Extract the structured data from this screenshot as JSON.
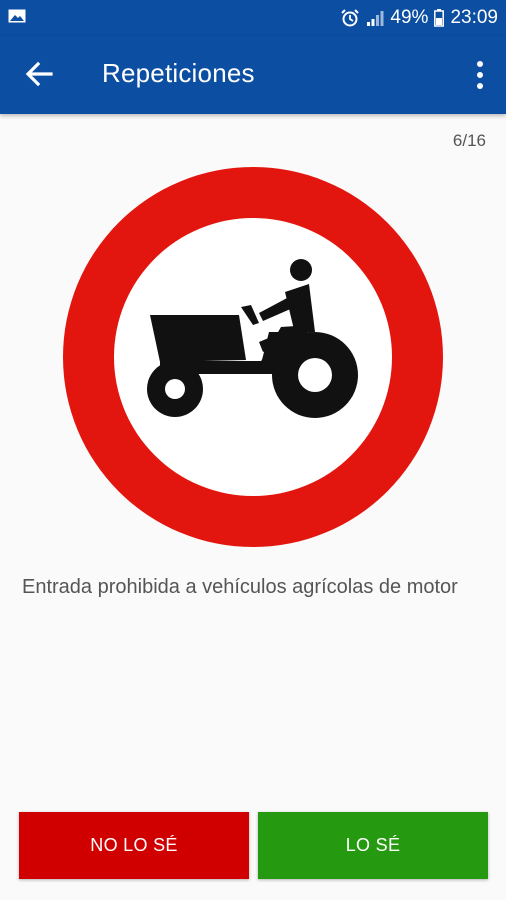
{
  "status_bar": {
    "battery": "49%",
    "time": "23:09",
    "icons": [
      "image-icon",
      "alarm-icon",
      "signal-icon",
      "battery-icon"
    ]
  },
  "app_bar": {
    "title": "Repeticiones",
    "background": "#0b4ea2"
  },
  "card": {
    "counter": "6/16",
    "sign_icon": "no-agricultural-vehicles-sign",
    "description": "Entrada prohibida a vehículos agrícolas de motor"
  },
  "actions": {
    "unknown_label": "NO LO SÉ",
    "known_label": "LO SÉ",
    "unknown_color": "#d10000",
    "known_color": "#259a11"
  }
}
